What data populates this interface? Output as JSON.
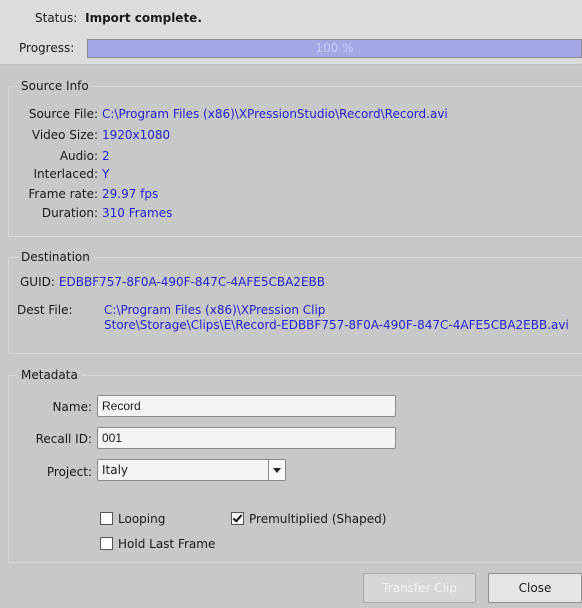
{
  "status": {
    "label": "Status:",
    "value": "Import complete."
  },
  "progress": {
    "label": "Progress:",
    "percent": 100,
    "text": "100 %"
  },
  "source_info": {
    "title": "Source Info",
    "rows": [
      {
        "label": "Source File:",
        "value": "C:\\Program Files (x86)\\XPressionStudio\\Record\\Record.avi"
      },
      {
        "label": "Video Size:",
        "value": "1920x1080"
      },
      {
        "label": "Audio:",
        "value": "2"
      },
      {
        "label": "Interlaced:",
        "value": "Y"
      },
      {
        "label": "Frame rate:",
        "value": "29.97 fps"
      },
      {
        "label": "Duration:",
        "value": "310 Frames"
      }
    ]
  },
  "destination": {
    "title": "Destination",
    "guid_label": "GUID:",
    "guid_value": "EDBBF757-8F0A-490F-847C-4AFE5CBA2EBB",
    "dest_file_label": "Dest File:",
    "dest_file_line1": "C:\\Program Files (x86)\\XPression Clip",
    "dest_file_line2": "Store\\Storage\\Clips\\E\\Record-EDBBF757-8F0A-490F-847C-4AFE5CBA2EBB.avi"
  },
  "metadata": {
    "title": "Metadata",
    "name_label": "Name:",
    "name_value": "Record",
    "recall_label": "Recall ID:",
    "recall_value": "001",
    "project_label": "Project:",
    "project_value": "Italy",
    "looping_label": "Looping",
    "looping_checked": false,
    "premult_label": "Premultiplied (Shaped)",
    "premult_checked": true,
    "hold_label": "Hold Last Frame",
    "hold_checked": false
  },
  "buttons": {
    "transfer": "Transfer Clip",
    "close": "Close"
  }
}
